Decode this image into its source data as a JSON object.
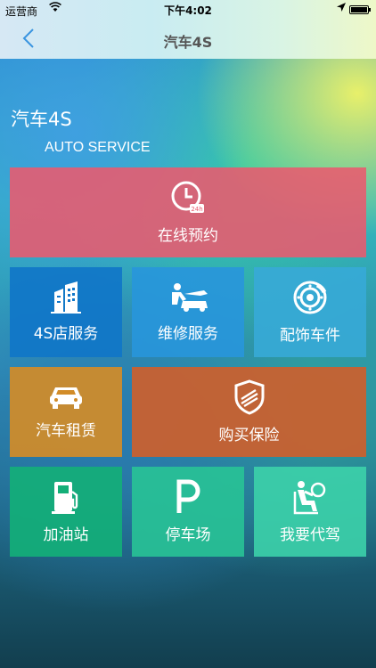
{
  "status_bar": {
    "carrier": "运营商",
    "time": "下午4:02",
    "wifi_icon": "wifi-icon",
    "location_icon": "location-arrow-icon",
    "battery_level": 1.0
  },
  "nav": {
    "title": "汽车4S",
    "back_icon": "chevron-left-icon"
  },
  "header": {
    "title": "汽车4S",
    "subtitle": "AUTO SERVICE"
  },
  "tiles": [
    {
      "label": "在线预约",
      "icon": "clock-24h-icon",
      "color": "#EB5A6E"
    },
    {
      "label": "4S店服务",
      "icon": "building-icon",
      "color": "#1076C8"
    },
    {
      "label": "维修服务",
      "icon": "mechanic-car-icon",
      "color": "#2896DC"
    },
    {
      "label": "配饰车件",
      "icon": "brake-disc-icon",
      "color": "#37AAD7"
    },
    {
      "label": "汽车租赁",
      "icon": "car-icon",
      "color": "#D28C28"
    },
    {
      "label": "购买保险",
      "icon": "shield-icon",
      "color": "#CD5F2D"
    },
    {
      "label": "加油站",
      "icon": "fuel-pump-icon",
      "color": "#14AF78"
    },
    {
      "label": "停车场",
      "icon": "parking-icon",
      "color": "#28C396"
    },
    {
      "label": "我要代驾",
      "icon": "driver-seat-icon",
      "color": "#3CD2AA"
    }
  ]
}
